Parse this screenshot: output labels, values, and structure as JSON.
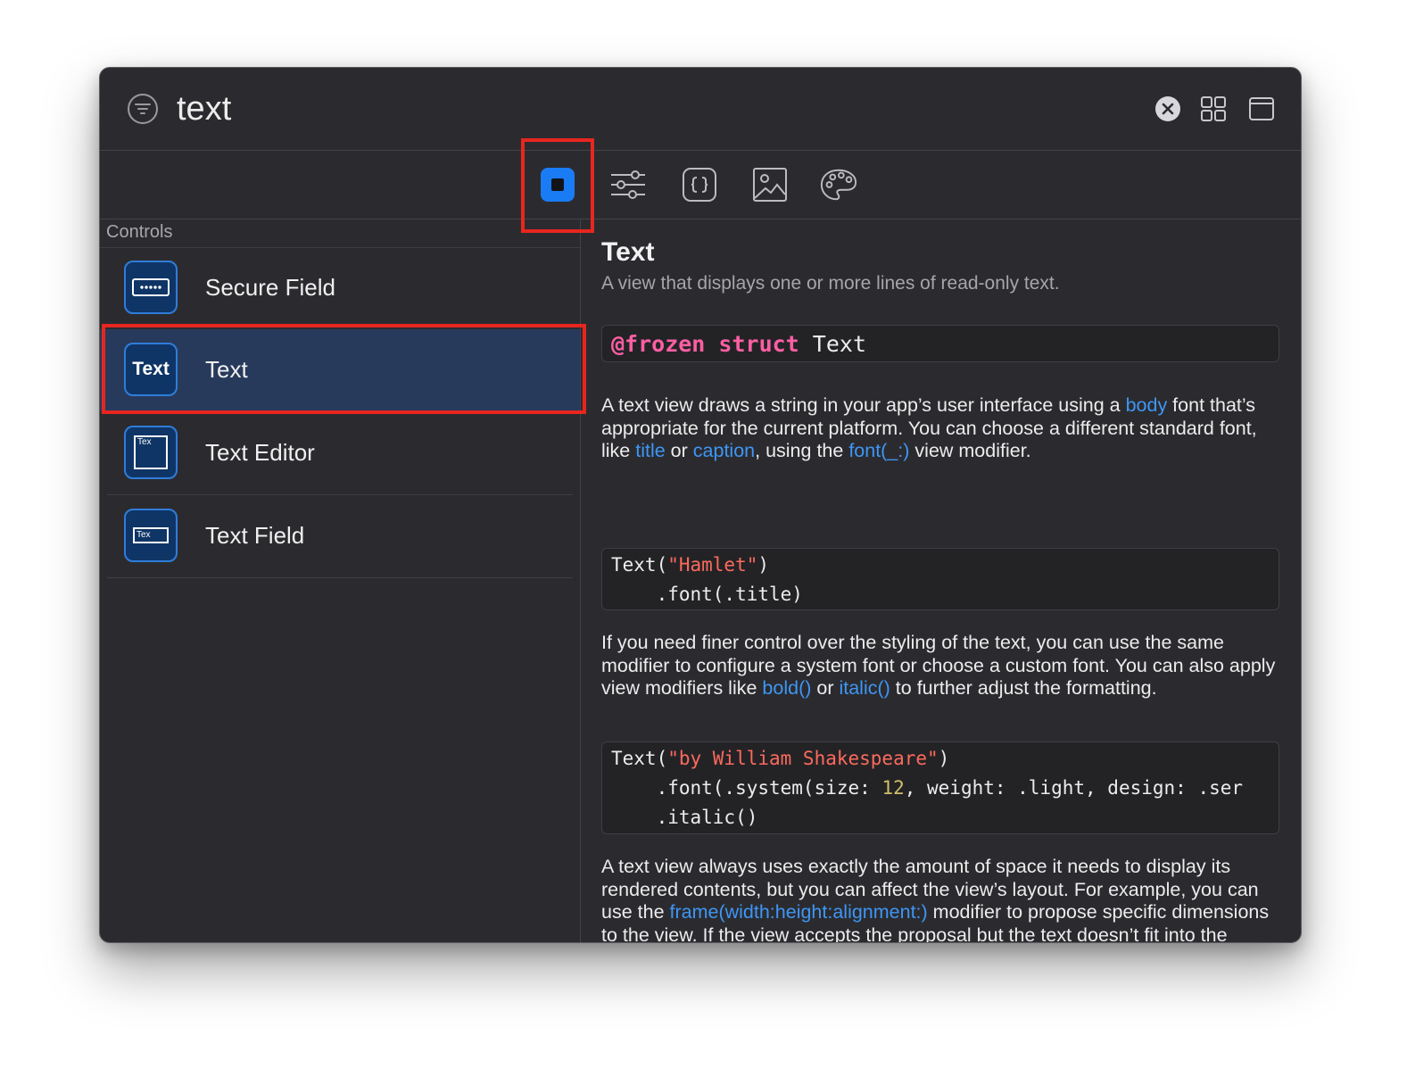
{
  "search": {
    "query": "text"
  },
  "sidebar": {
    "section_title": "Controls",
    "items": [
      {
        "label": "Secure Field",
        "icon": "secure-field-icon"
      },
      {
        "label": "Text",
        "icon": "text-icon",
        "icon_text": "Text",
        "selected": true
      },
      {
        "label": "Text Editor",
        "icon": "text-editor-icon",
        "icon_text": "Tex"
      },
      {
        "label": "Text Field",
        "icon": "text-field-icon",
        "icon_text": "Tex"
      }
    ]
  },
  "tabs": [
    {
      "name": "views",
      "icon": "square-fill-icon",
      "active": true
    },
    {
      "name": "modifiers",
      "icon": "sliders-icon"
    },
    {
      "name": "snippets",
      "icon": "curly-braces-icon"
    },
    {
      "name": "images",
      "icon": "photo-icon"
    },
    {
      "name": "colors",
      "icon": "palette-icon"
    }
  ],
  "detail": {
    "title": "Text",
    "subtitle": "A view that displays one or more lines of read-only text.",
    "declaration": {
      "kw1": "@frozen",
      "kw2": "struct",
      "name": "Text"
    },
    "para1": {
      "t1": "A text view draws a string in your app’s user interface using a ",
      "l1": "body",
      "t2": " font that’s appropriate for the current platform. You can choose a different standard font, like ",
      "l2": "title",
      "t3": " or ",
      "l3": "caption",
      "t4": ", using the ",
      "l4": "font(_:)",
      "t5": " view modifier."
    },
    "code1": {
      "l1_a": "Text(",
      "l1_str": "\"Hamlet\"",
      "l1_b": ")",
      "l2": "    .font(.title)"
    },
    "para2": {
      "t1": "If you need finer control over the styling of the text, you can use the same modifier to configure a system font or choose a custom font. You can also apply view modifiers like ",
      "l1": "bold()",
      "t2": " or ",
      "l2": "italic()",
      "t3": " to further adjust the formatting."
    },
    "code2": {
      "l1_a": "Text(",
      "l1_str": "\"by William Shakespeare\"",
      "l1_b": ")",
      "l2_a": "    .font(.system(size: ",
      "l2_num": "12",
      "l2_b": ", weight: .light, design: .ser",
      "l3": "    .italic()"
    },
    "para3": {
      "t1": "A text view always uses exactly the amount of space it needs to display its rendered contents, but you can affect the view’s layout. For example, you can use the ",
      "l1": "frame(width:height:alignment:)",
      "t2": " modifier to propose specific dimensions to the view. If the view accepts the proposal but the text doesn’t fit into the available space, the view uses a combination of wrapping, tightening, scaling, and truncation to make it fit. With a width of 100 points but no constraint on the height, a text view might wrap a"
    }
  },
  "colors": {
    "accent": "#1a7cf5",
    "link": "#3e96f5",
    "highlight": "#e8261f",
    "selection": "#273a5b"
  }
}
